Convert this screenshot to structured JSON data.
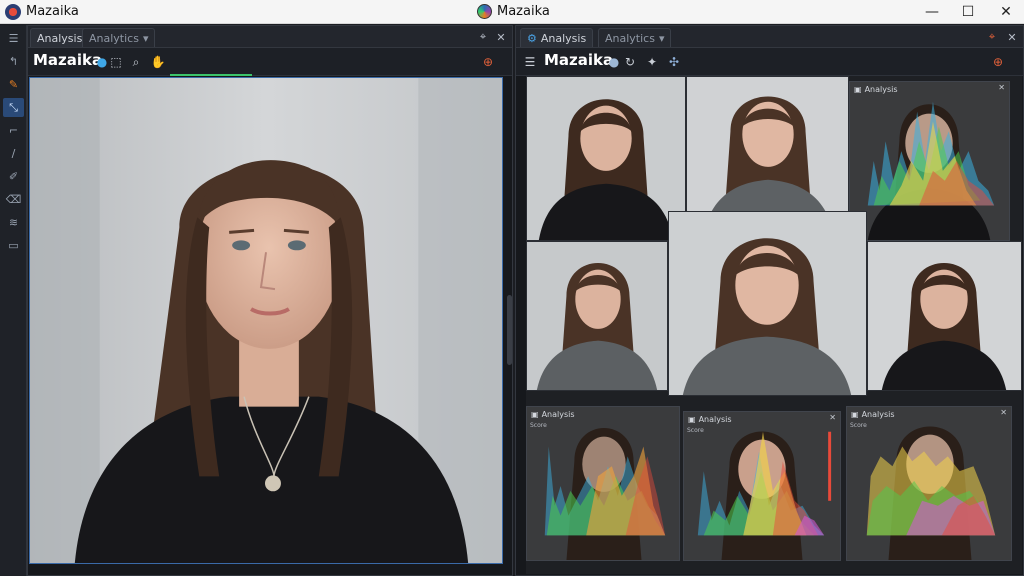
{
  "window": {
    "title": "Mazaika",
    "center_title": "Mazaika",
    "controls": {
      "minimize": "—",
      "maximize": "☐",
      "close": "✕"
    }
  },
  "left_panel": {
    "tabs": [
      {
        "label": "Analysis",
        "active": true
      },
      {
        "label": "Analytics",
        "active": false
      }
    ],
    "brand": "Mazaika"
  },
  "right_panel": {
    "tabs": [
      {
        "label": "Analysis",
        "active": true
      },
      {
        "label": "Analytics",
        "active": false
      }
    ],
    "brand": "Mazaika",
    "histogram_titles": [
      "Analysis",
      "Analysis",
      "Analysis",
      "Analysis"
    ],
    "histogram_axis_labels": [
      "Score",
      "Score",
      "Score"
    ]
  },
  "tools": [
    "move-tool",
    "brush-tool",
    "select-tool",
    "crop-tool",
    "pen-tool",
    "pencil-tool",
    "eraser-tool",
    "layers-tool",
    "frame-tool"
  ],
  "colors": {
    "accent": "#2a4a78",
    "panel_bg": "#16181c",
    "titlebar_bg": "#f5f5f5"
  }
}
